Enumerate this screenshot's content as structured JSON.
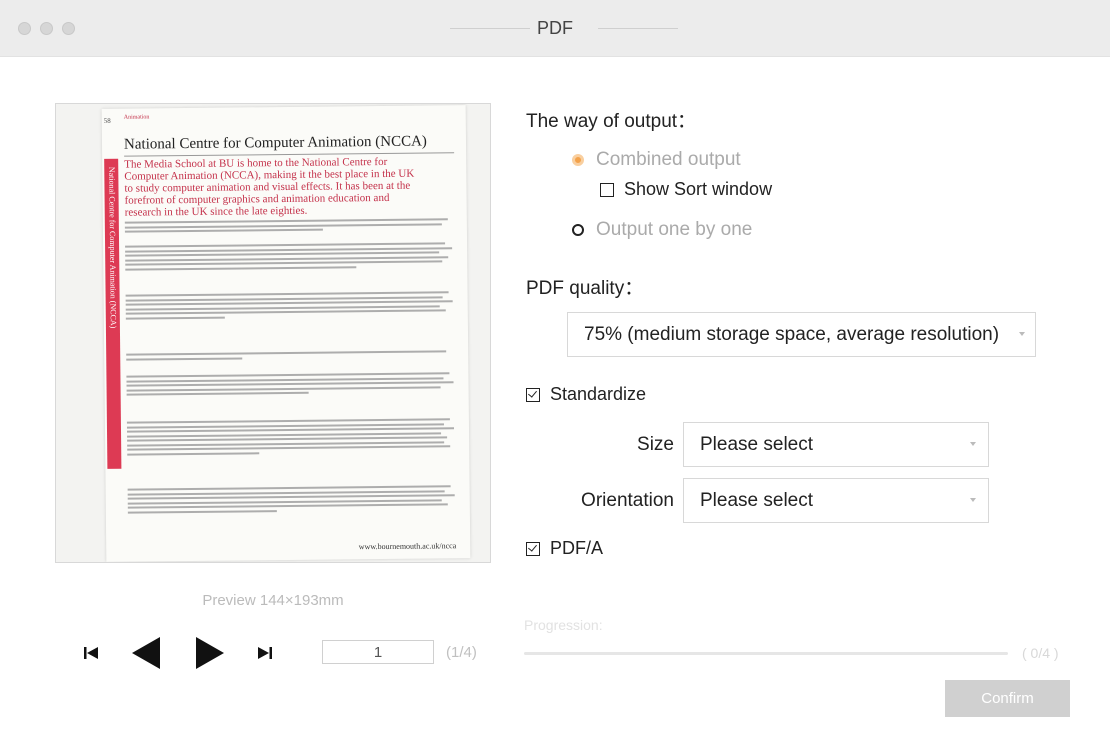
{
  "window": {
    "title": "PDF"
  },
  "preview": {
    "page_header": "Animation",
    "page_number": "58",
    "doc_title": "National Centre for Computer Animation (NCCA)",
    "side_text": "National Centre for Computer Animation (NCCA)",
    "lead": "The Media School at BU is home to the National Centre for Computer Animation (NCCA), making it the best place in the UK to study computer animation and visual effects. It has been at the forefront of computer graphics and animation education and research in the UK since the late eighties.",
    "url": "www.bournemouth.ac.uk/ncca",
    "label": "Preview  144×193mm"
  },
  "pager": {
    "current_page": "1",
    "total": "(1/4)"
  },
  "output": {
    "label": "The way of output：",
    "combined": "Combined output",
    "show_sort": "Show Sort window",
    "one_by_one": "Output one by one"
  },
  "quality": {
    "label": "PDF quality：",
    "selected": "75% (medium storage space, average resolution)"
  },
  "standardize": {
    "label": "Standardize",
    "checked": true,
    "size_label": "Size",
    "size_value": "Please select",
    "orientation_label": "Orientation",
    "orientation_value": "Please select"
  },
  "pdfa": {
    "label": "PDF/A",
    "checked": true
  },
  "progress": {
    "label": "Progression:",
    "count": "( 0/4 )",
    "fraction": 0
  },
  "confirm_label": "Confirm",
  "colors": {
    "accent": "#f3a24b",
    "doc_red": "#dd3a54",
    "disabled": "#d0d0d0"
  }
}
